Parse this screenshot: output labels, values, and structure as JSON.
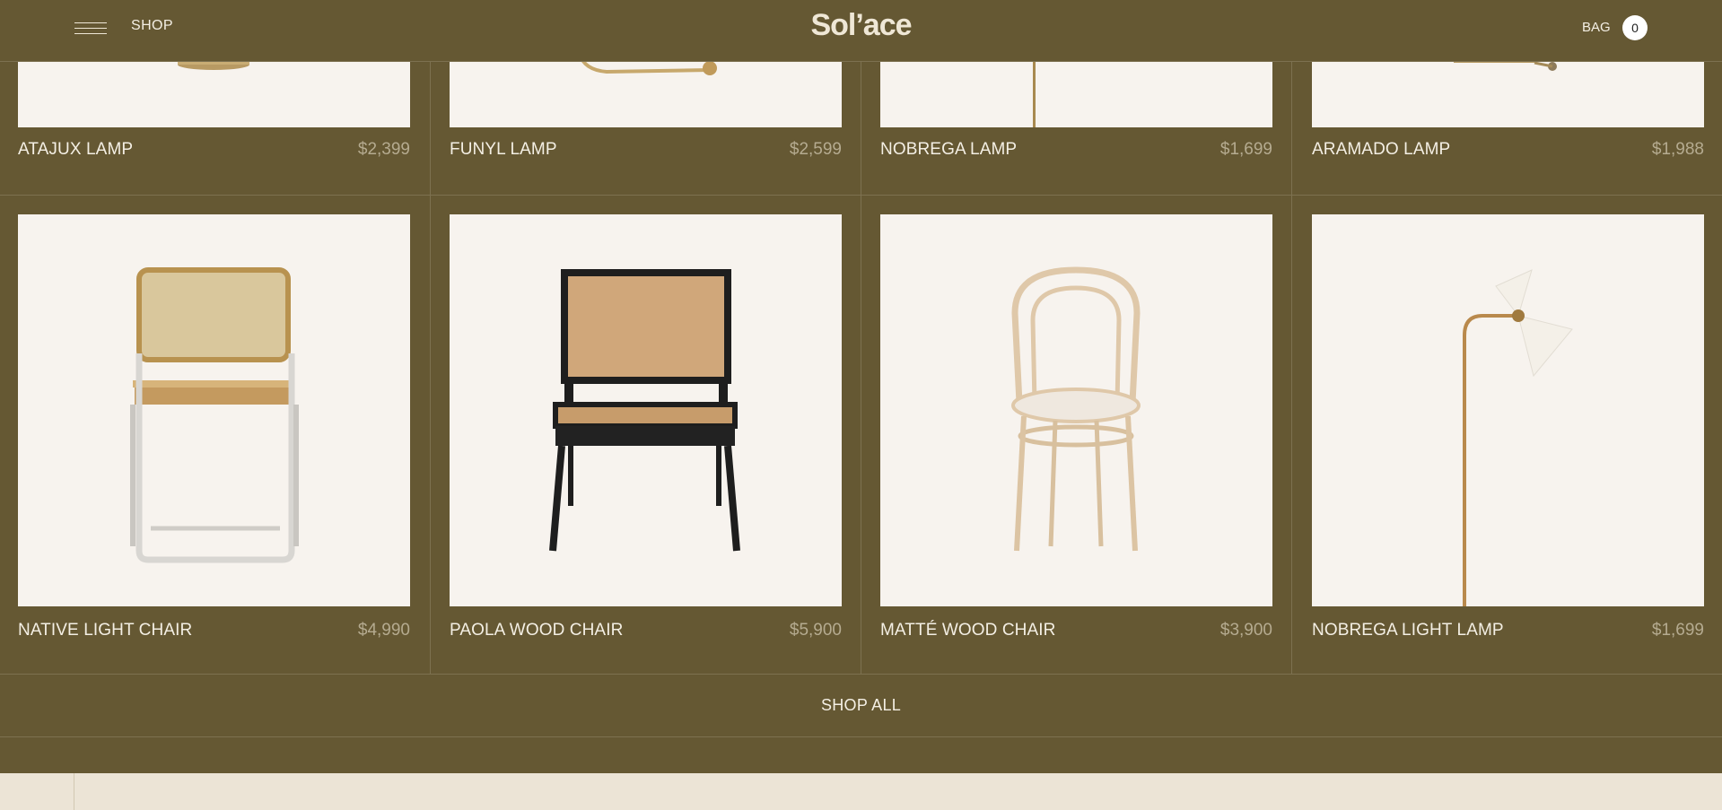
{
  "header": {
    "menu_icon": "hamburger-menu-icon",
    "shop_label": "SHOP",
    "logo": "Sol’ace",
    "bag_label": "BAG",
    "bag_count": "0"
  },
  "products_row1": [
    {
      "name": "ATAJUX LAMP",
      "price": "$2,399",
      "image": "brass-wall-lamp"
    },
    {
      "name": "FUNYL LAMP",
      "price": "$2,599",
      "image": "brass-arm-lamp"
    },
    {
      "name": "NOBREGA LAMP",
      "price": "$1,699",
      "image": "brass-floor-lamp"
    },
    {
      "name": "ARAMADO LAMP",
      "price": "$1,988",
      "image": "brass-wall-sconce"
    }
  ],
  "products_row2": [
    {
      "name": "NATIVE LIGHT CHAIR",
      "price": "$4,990",
      "image": "cane-cantilever-chair"
    },
    {
      "name": "PAOLA WOOD CHAIR",
      "price": "$5,900",
      "image": "black-cane-lounge-chair"
    },
    {
      "name": "MATTÉ WOOD CHAIR",
      "price": "$3,900",
      "image": "bentwood-chair"
    },
    {
      "name": "NOBREGA LIGHT LAMP",
      "price": "$1,699",
      "image": "cream-floor-lamp"
    }
  ],
  "shop_all_label": "SHOP ALL",
  "colors": {
    "background": "#655833",
    "card_bg": "#f7f3ee",
    "text": "#f4efe4",
    "price": "#b5ab90",
    "footer": "#ece4d6"
  }
}
